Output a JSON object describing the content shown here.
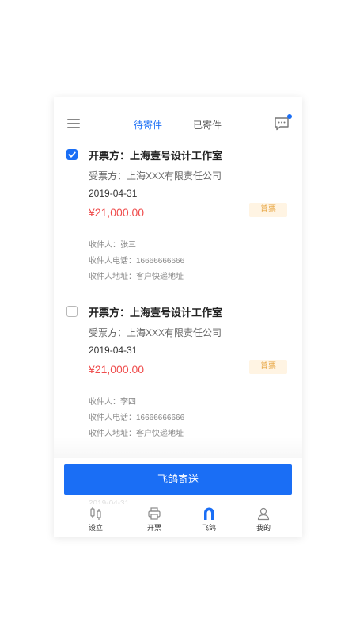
{
  "header": {
    "tabs": [
      {
        "label": "待寄件",
        "active": true
      },
      {
        "label": "已寄件",
        "active": false
      }
    ],
    "has_notification": true
  },
  "invoices": [
    {
      "checked": true,
      "issuer": "开票方：上海壹号设计工作室",
      "receiver": "受票方：上海XXX有限责任公司",
      "date": "2019-04-31",
      "amount": "¥21,000.00",
      "badge": "普票",
      "recipient": "收件人：张三",
      "phone": "收件人电话：16666666666",
      "address": "收件人地址：客户快递地址"
    },
    {
      "checked": false,
      "issuer": "开票方：上海壹号设计工作室",
      "receiver": "受票方：上海XXX有限责任公司",
      "date": "2019-04-31",
      "amount": "¥21,000.00",
      "badge": "普票",
      "recipient": "收件人：李四",
      "phone": "收件人电话：16666666666",
      "address": "收件人地址：客户快递地址"
    }
  ],
  "action_button": "飞鸽寄送",
  "tabbar": [
    {
      "label": "设立",
      "icon": "setup-icon",
      "active": false
    },
    {
      "label": "开票",
      "icon": "printer-icon",
      "active": false
    },
    {
      "label": "飞鸽",
      "icon": "feige-icon",
      "active": true
    },
    {
      "label": "我的",
      "icon": "user-icon",
      "active": false
    }
  ],
  "colors": {
    "primary": "#1a6ef5",
    "amount": "#ef4d4d",
    "badge_bg": "#fff4e3",
    "badge_text": "#e7a542"
  }
}
